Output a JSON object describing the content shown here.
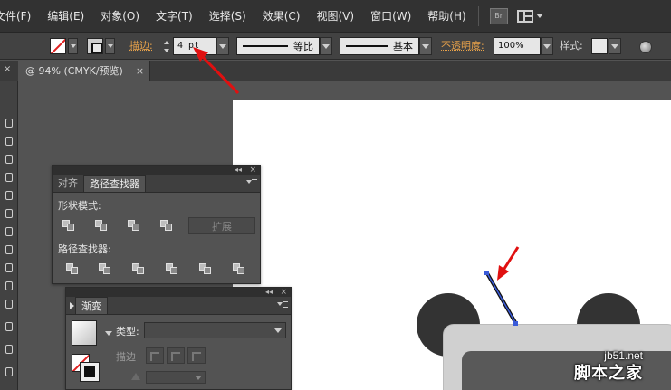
{
  "menu": {
    "items": [
      "文件(F)",
      "编辑(E)",
      "对象(O)",
      "文字(T)",
      "选择(S)",
      "效果(C)",
      "视图(V)",
      "窗口(W)",
      "帮助(H)"
    ],
    "bridge_label": "Br"
  },
  "control_bar": {
    "stroke_label": "描边:",
    "stroke_weight": "4 pt",
    "variable_width_label": "等比",
    "brush_label": "基本",
    "opacity_label": "不透明度:",
    "opacity_value": "100%",
    "style_label": "样式:"
  },
  "document_tab": {
    "title": "@ 94% (CMYK/预览)",
    "close_glyph": "×"
  },
  "pathfinder_panel": {
    "tabs": [
      "对齐",
      "路径查找器"
    ],
    "active_tab": 1,
    "shape_modes_label": "形状模式:",
    "pathfinders_label": "路径查找器:",
    "expand_label": "扩展",
    "collapse_glyph": "◂◂",
    "close_glyph": "×"
  },
  "gradient_panel": {
    "title": "渐变",
    "type_label": "类型:",
    "stroke_label": "描边",
    "collapse_glyph": "◂◂",
    "close_glyph": "×"
  },
  "watermark": {
    "site": "jb51.net",
    "name": "脚本之家"
  },
  "colors": {
    "menubar": "#323232",
    "panel": "#535353",
    "accent_orange": "#e8a24a",
    "arrow_red": "#e01010",
    "selected_path": "#3a5bd9",
    "artboard": "#ffffff",
    "panda_dark": "#333333",
    "panda_light": "#d0d0d0"
  },
  "icons": [
    "fill-none-icon",
    "stroke-swatch-icon",
    "spinner-icon",
    "dropdown-arrow-icon",
    "globe-icon",
    "workspace-layout-icon",
    "panel-menu-icon",
    "collapse-icon",
    "close-icon",
    "fill-stroke-icon"
  ]
}
